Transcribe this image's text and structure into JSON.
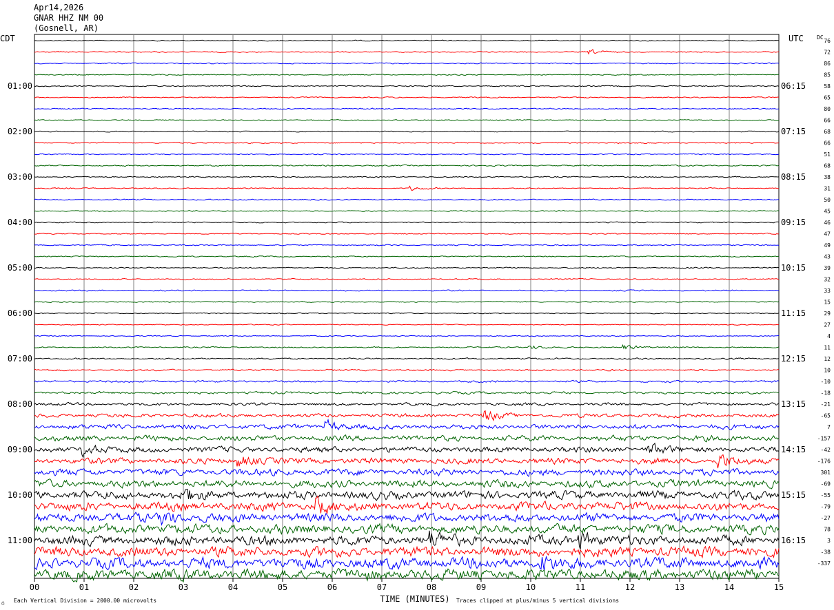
{
  "header": {
    "date": "Apr14,2026",
    "station": "GNAR HHZ NM 00",
    "location": "(Gosnell, AR)"
  },
  "left_tz": "CDT",
  "right_tz": "UTC",
  "dc_label": "DC",
  "footer": {
    "left_mark": "⌂",
    "scale_note": "Each Vertical Division = 2000.00 microvolts",
    "clip_note": "Traces clipped at plus/minus 5 vertical divisions"
  },
  "colors": {
    "cycle": [
      "#000000",
      "#ff0000",
      "#0000ff",
      "#006400"
    ],
    "grid": "#808080"
  },
  "chart_data": {
    "type": "helicorder",
    "title": "Apr14,2026  GNAR HHZ NM 00  (Gosnell, AR)",
    "xlabel": "TIME (MINUTES)",
    "xlim": [
      0,
      15
    ],
    "x_ticks": [
      "00",
      "01",
      "02",
      "03",
      "04",
      "05",
      "06",
      "07",
      "08",
      "09",
      "10",
      "11",
      "12",
      "13",
      "14",
      "15"
    ],
    "trace_minutes": 15,
    "trace_count": 48,
    "left_time_labels": [
      {
        "trace": 4,
        "label": "01:00"
      },
      {
        "trace": 8,
        "label": "02:00"
      },
      {
        "trace": 12,
        "label": "03:00"
      },
      {
        "trace": 16,
        "label": "04:00"
      },
      {
        "trace": 20,
        "label": "05:00"
      },
      {
        "trace": 24,
        "label": "06:00"
      },
      {
        "trace": 28,
        "label": "07:00"
      },
      {
        "trace": 32,
        "label": "08:00"
      },
      {
        "trace": 36,
        "label": "09:00"
      },
      {
        "trace": 40,
        "label": "10:00"
      },
      {
        "trace": 44,
        "label": "11:00"
      }
    ],
    "right_time_labels": [
      {
        "trace": 4,
        "label": "06:15"
      },
      {
        "trace": 8,
        "label": "07:15"
      },
      {
        "trace": 12,
        "label": "08:15"
      },
      {
        "trace": 16,
        "label": "09:15"
      },
      {
        "trace": 20,
        "label": "10:15"
      },
      {
        "trace": 24,
        "label": "11:15"
      },
      {
        "trace": 28,
        "label": "12:15"
      },
      {
        "trace": 32,
        "label": "13:15"
      },
      {
        "trace": 36,
        "label": "14:15"
      },
      {
        "trace": 40,
        "label": "15:15"
      },
      {
        "trace": 44,
        "label": "16:15"
      }
    ],
    "dc_offsets": [
      76,
      72,
      86,
      85,
      58,
      65,
      80,
      66,
      68,
      66,
      51,
      68,
      38,
      31,
      50,
      45,
      46,
      47,
      49,
      43,
      39,
      32,
      33,
      15,
      29,
      27,
      4,
      11,
      12,
      10,
      -10,
      -18,
      -21,
      -65,
      7,
      -157,
      -42,
      -176,
      301,
      -69,
      -55,
      -79,
      -27,
      78,
      3,
      -38,
      -337
    ],
    "noise_level": [
      0.5,
      0.6,
      0.6,
      0.6,
      0.6,
      0.6,
      0.6,
      0.6,
      0.6,
      0.7,
      0.6,
      0.7,
      0.6,
      0.6,
      0.6,
      0.6,
      0.6,
      0.6,
      0.6,
      0.6,
      0.6,
      0.7,
      0.7,
      0.6,
      0.5,
      0.5,
      0.5,
      0.7,
      0.8,
      0.9,
      1.1,
      1.3,
      1.5,
      2.0,
      2.6,
      3.0,
      3.0,
      3.2,
      3.6,
      4.0,
      4.4,
      4.6,
      4.8,
      5.0,
      5.2,
      5.4,
      5.8,
      6.0
    ],
    "events": [
      {
        "trace": 1,
        "minute": 11.2,
        "amp": 3
      },
      {
        "trace": 13,
        "minute": 7.6,
        "amp": 3
      },
      {
        "trace": 27,
        "minute": 10.0,
        "amp": 3
      },
      {
        "trace": 27,
        "minute": 11.9,
        "amp": 4
      },
      {
        "trace": 33,
        "minute": 9.1,
        "amp": 8
      },
      {
        "trace": 34,
        "minute": 5.9,
        "amp": 8
      },
      {
        "trace": 36,
        "minute": 1.0,
        "amp": 8
      },
      {
        "trace": 36,
        "minute": 12.4,
        "amp": 8
      },
      {
        "trace": 37,
        "minute": 4.1,
        "amp": 10
      },
      {
        "trace": 37,
        "minute": 13.8,
        "amp": 10
      },
      {
        "trace": 40,
        "minute": 3.0,
        "amp": 10
      },
      {
        "trace": 41,
        "minute": 5.7,
        "amp": 12
      },
      {
        "trace": 42,
        "minute": 2.6,
        "amp": 10
      },
      {
        "trace": 44,
        "minute": 8.0,
        "amp": 10
      },
      {
        "trace": 44,
        "minute": 11.0,
        "amp": 10
      },
      {
        "trace": 46,
        "minute": 10.2,
        "amp": 12
      }
    ]
  }
}
